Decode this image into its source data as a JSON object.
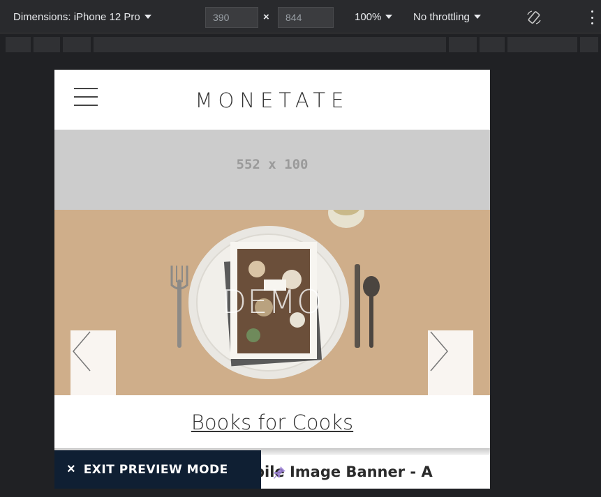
{
  "devtools": {
    "dimensions_label": "Dimensions: iPhone 12 Pro",
    "width_value": "390",
    "height_value": "844",
    "times_symbol": "×",
    "zoom": "100%",
    "throttling": "No throttling",
    "icons": [
      "caret-down-icon",
      "rotate-icon",
      "more-vertical-icon"
    ]
  },
  "site": {
    "logo": "MONETATE",
    "placeholder_text": "552 x 100",
    "hero_watermark": "DEMO",
    "caption_link": "Books for Cooks",
    "experience_label": "bile Image Banner - A",
    "exit_preview": "EXIT PREVIEW MODE",
    "exit_icon": "×",
    "hero_bg_color": "#cfae8a"
  }
}
